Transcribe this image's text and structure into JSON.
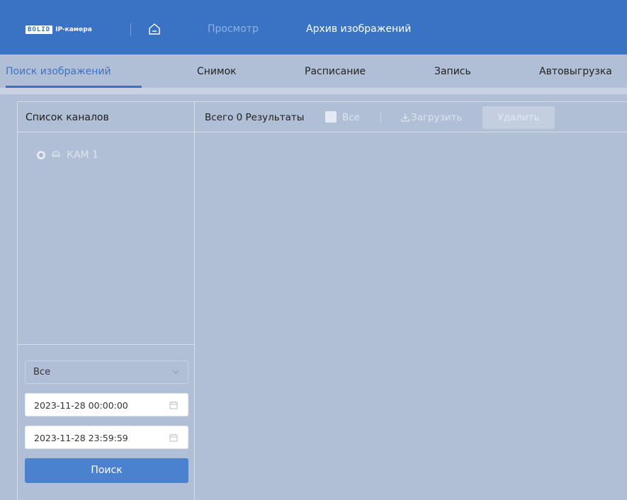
{
  "header": {
    "logo_brand": "BOLID",
    "logo_text": "IP-камера",
    "nav": [
      "Просмотр",
      "Архив изображений"
    ]
  },
  "tabs": [
    "Поиск изображений",
    "Снимок",
    "Расписание",
    "Запись",
    "Автовыгрузка"
  ],
  "left": {
    "title": "Список каналов",
    "channel": "КАМ 1",
    "filter_select": "Все",
    "start_time": "2023-11-28 00:00:00",
    "end_time": "2023-11-28 23:59:59",
    "search_label": "Поиск"
  },
  "right": {
    "total_label": "Всего 0 Результаты",
    "all_label": "Все",
    "download_label": "Загрузить",
    "delete_label": "Удалить"
  },
  "colors": {
    "header": "#3a73c4",
    "background": "#b0bfd6",
    "accent": "#4a82d0"
  }
}
